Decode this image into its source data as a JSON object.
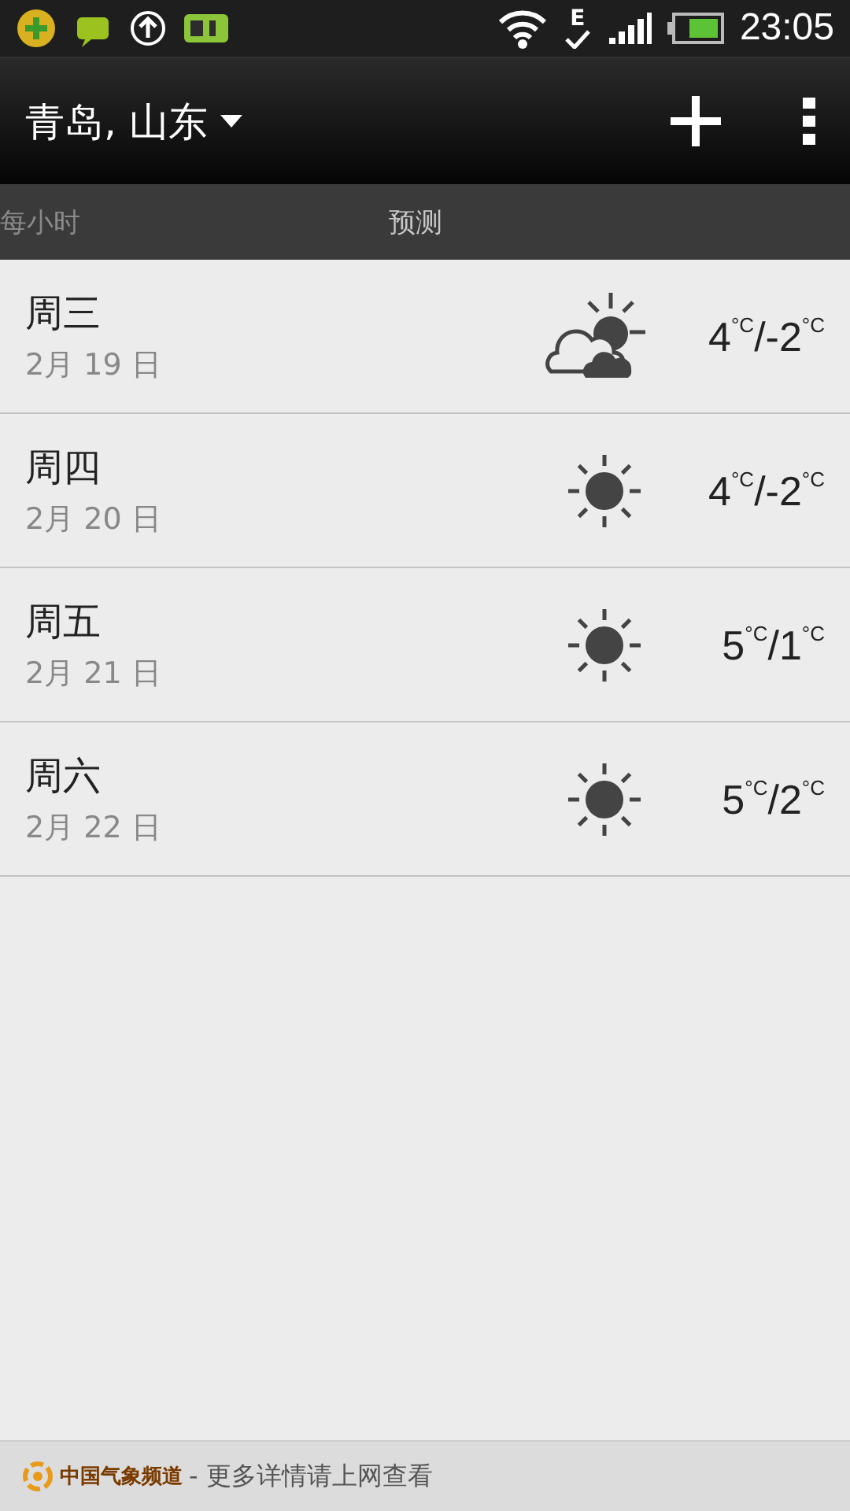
{
  "status_bar": {
    "network_type": "E",
    "time": "23:05"
  },
  "header": {
    "location": "青岛, 山东"
  },
  "tabs": [
    {
      "label": "每小时",
      "selected": false
    },
    {
      "label": "预测",
      "selected": true
    }
  ],
  "days": [
    {
      "weekday": "周三",
      "date": "2月 19 日",
      "kind": "partly_cloudy",
      "high": "4",
      "high_unit": "°C",
      "low": "/-2",
      "low_unit": "°C"
    },
    {
      "weekday": "周四",
      "date": "2月 20 日",
      "kind": "sunny",
      "high": "4",
      "high_unit": "°C",
      "low": "/-2",
      "low_unit": "°C"
    },
    {
      "weekday": "周五",
      "date": "2月 21 日",
      "kind": "sunny",
      "high": "5",
      "high_unit": "°C",
      "low": "/1",
      "low_unit": "°C"
    },
    {
      "weekday": "周六",
      "date": "2月 22 日",
      "kind": "sunny",
      "high": "5",
      "high_unit": "°C",
      "low": "/2",
      "low_unit": "°C"
    }
  ],
  "footer": {
    "brand": "中国气象频道",
    "text": "- 更多详情请上网查看"
  }
}
